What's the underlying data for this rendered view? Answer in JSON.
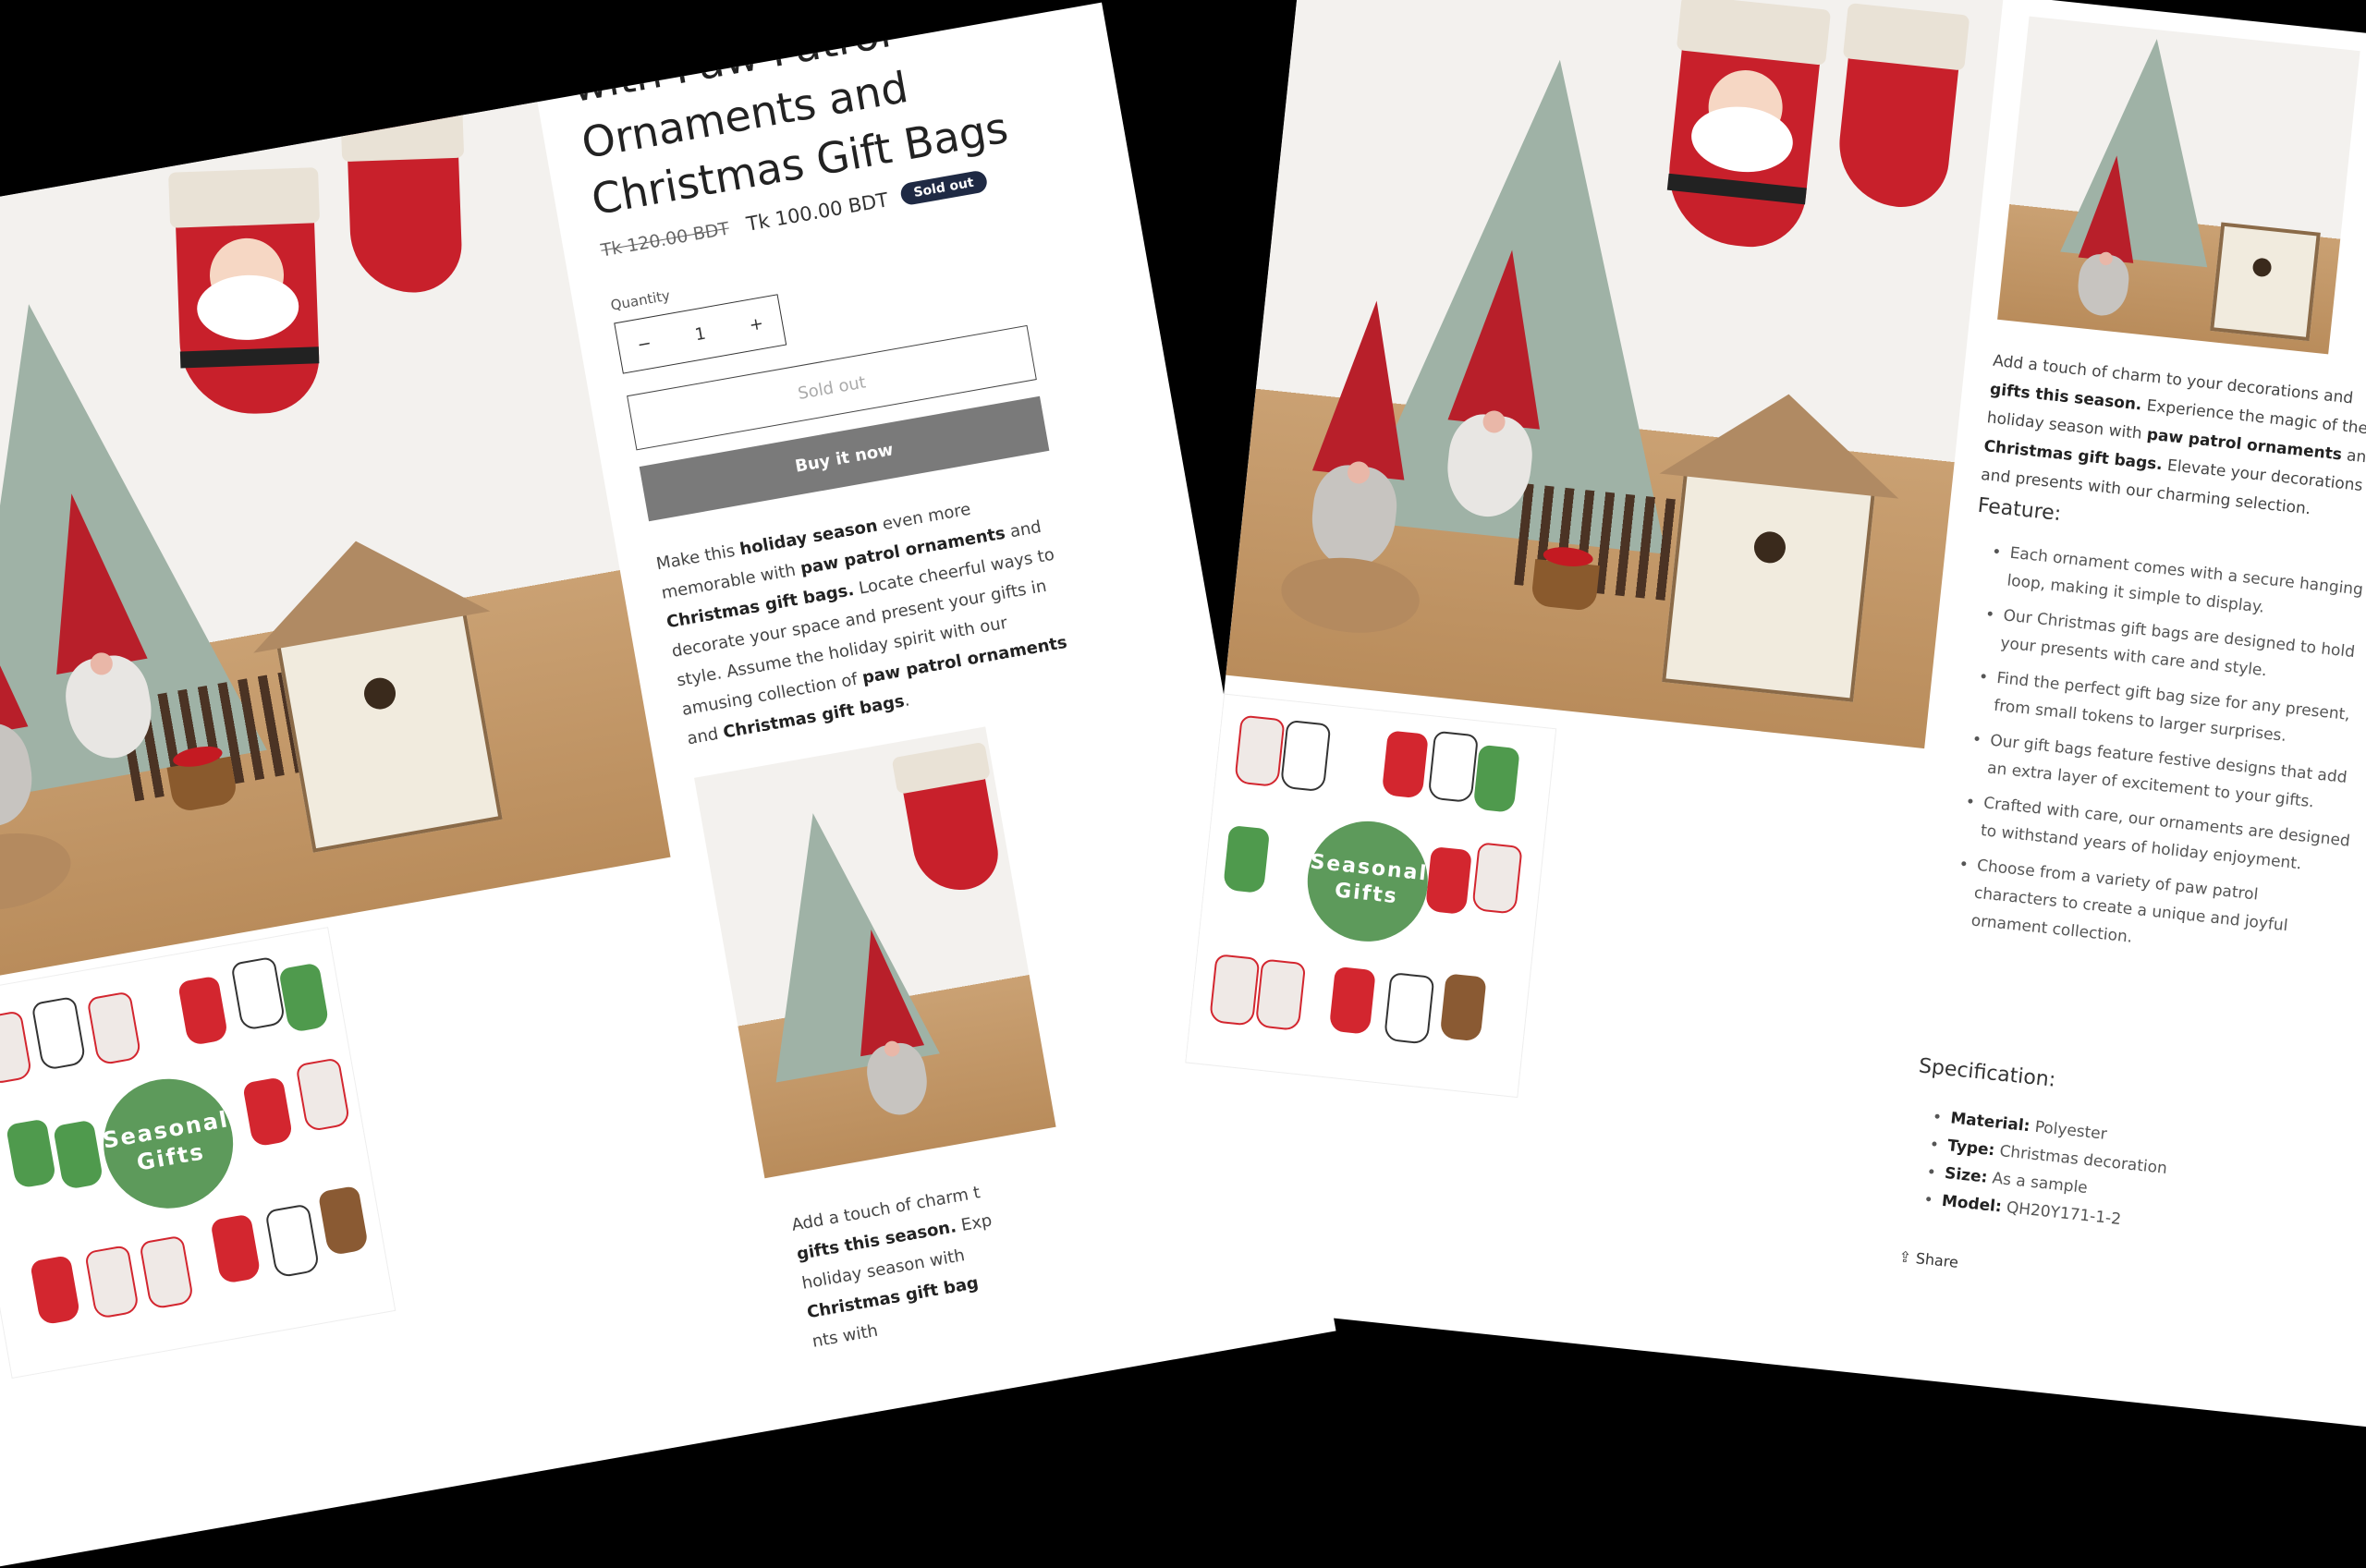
{
  "product": {
    "title_lines": [
      "with Paw Patrol",
      "Ornaments and",
      "Christmas Gift Bags"
    ],
    "price_old": "Tk 120.00 BDT",
    "price_new": "Tk 100.00 BDT",
    "sold_badge": "Sold out",
    "quantity_label": "Quantity",
    "quantity_value": "1",
    "minus": "−",
    "plus": "+",
    "sold_out_button": "Sold out",
    "buy_button": "Buy it now"
  },
  "gift_badge": {
    "line1": "Seasonal",
    "line2": "Gifts"
  },
  "description_a": {
    "t1": "Make this ",
    "b1": "holiday season",
    "t2": " even more memorable with ",
    "b2": "paw patrol ornaments",
    "t3": " and ",
    "b3": "Christmas gift bags.",
    "t4": " Locate cheerful ways to decorate your space and present your gifts in style. Assume the holiday spirit with our amusing collection of ",
    "b4": "paw patrol ornaments",
    "t5": " and ",
    "b5": "Christmas gift bags",
    "t6": "."
  },
  "description_b": {
    "t1": "Add a touch of charm to your decorations and ",
    "b1": "gifts this season.",
    "t2": " Experience the magic of the holiday season with ",
    "b2": "paw patrol ornaments",
    "t3": " and ",
    "b3": "Christmas gift bags.",
    "t4": " Elevate your decorations and presents with our charming selection."
  },
  "description_b_partial": {
    "t1": "Add a touch of charm t",
    "b1": "gifts this season.",
    "t2": " Exp",
    "t3": "holiday season with",
    "b3": "Christmas gift bag",
    "t4": "nts with"
  },
  "feature": {
    "label": "Feature:",
    "items": [
      "Each ornament comes with a secure hanging loop, making it simple to display.",
      "Our Christmas gift bags are designed to hold your presents with care and style.",
      "Find the perfect gift bag size for any present, from small tokens to larger surprises.",
      "Our gift bags feature festive designs that add an extra layer of excitement to your gifts.",
      "Crafted with care, our ornaments are designed to withstand years of holiday enjoyment.",
      "Choose from a variety of paw patrol characters to create a unique and joyful ornament collection."
    ]
  },
  "specification": {
    "label": "Specification:",
    "items": [
      {
        "k": "Material:",
        "v": " Polyester"
      },
      {
        "k": "Type:",
        "v": " Christmas decoration"
      },
      {
        "k": "Size:",
        "v": " As a sample"
      },
      {
        "k": "Model:",
        "v": " QH20Y171-1-2"
      }
    ]
  },
  "share": "Share",
  "icons": {
    "share": "share-icon"
  },
  "colors": {
    "badge_green": "#5d9a5b",
    "stocking_red": "#c8202b",
    "sold_badge": "#1f2a44",
    "buy_button": "#7a7a7a"
  }
}
